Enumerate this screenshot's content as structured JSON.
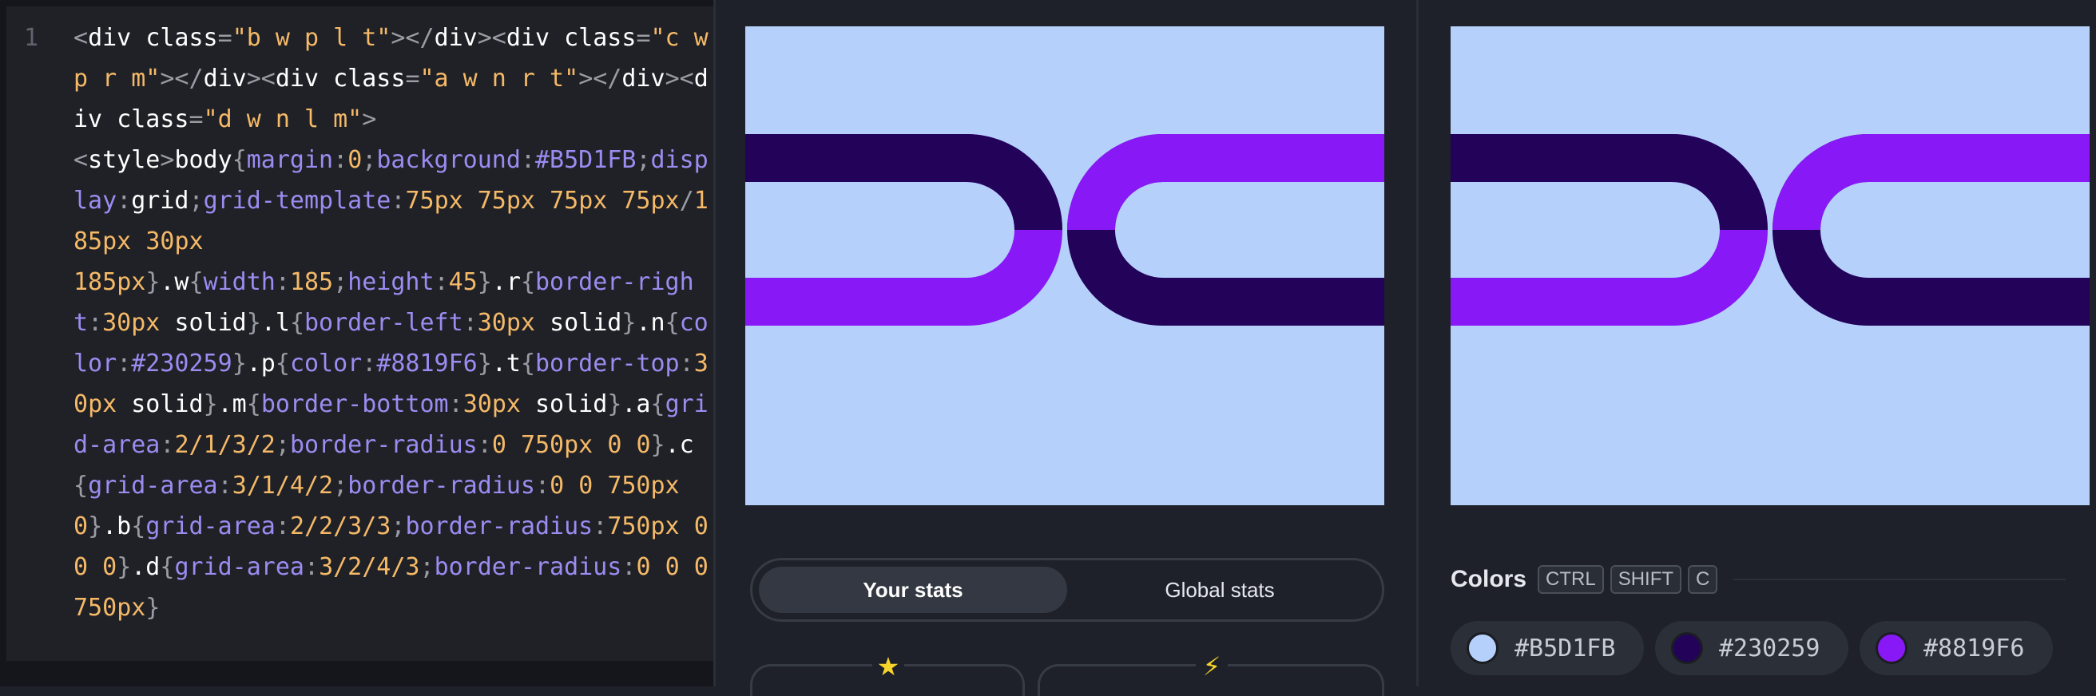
{
  "editor": {
    "line_number": "1",
    "code_tokens": [
      {
        "t": "<",
        "c": "pu"
      },
      {
        "t": "div ",
        "c": "tg"
      },
      {
        "t": "class",
        "c": "at"
      },
      {
        "t": "=",
        "c": "pu"
      },
      {
        "t": "\"b w p l t\"",
        "c": "st"
      },
      {
        "t": "></",
        "c": "pu"
      },
      {
        "t": "div",
        "c": "tg"
      },
      {
        "t": "><",
        "c": "pu"
      },
      {
        "t": "div ",
        "c": "tg"
      },
      {
        "t": "class",
        "c": "at"
      },
      {
        "t": "=",
        "c": "pu"
      },
      {
        "t": "\"c w p r m\"",
        "c": "st"
      },
      {
        "t": "></",
        "c": "pu"
      },
      {
        "t": "div",
        "c": "tg"
      },
      {
        "t": "><",
        "c": "pu"
      },
      {
        "t": "div ",
        "c": "tg"
      },
      {
        "t": "class",
        "c": "at"
      },
      {
        "t": "=",
        "c": "pu"
      },
      {
        "t": "\"a w n r t\"",
        "c": "st"
      },
      {
        "t": "></",
        "c": "pu"
      },
      {
        "t": "div",
        "c": "tg"
      },
      {
        "t": "><",
        "c": "pu"
      },
      {
        "t": "div ",
        "c": "tg"
      },
      {
        "t": "class",
        "c": "at"
      },
      {
        "t": "=",
        "c": "pu"
      },
      {
        "t": "\"d w n l m\"",
        "c": "st"
      },
      {
        "t": ">",
        "c": "pu"
      },
      {
        "t": "\n",
        "c": "pu"
      },
      {
        "t": "<",
        "c": "pu"
      },
      {
        "t": "style",
        "c": "tg"
      },
      {
        "t": ">",
        "c": "pu"
      },
      {
        "t": "body",
        "c": "sel"
      },
      {
        "t": "{",
        "c": "pu"
      },
      {
        "t": "margin",
        "c": "pr"
      },
      {
        "t": ":",
        "c": "pu"
      },
      {
        "t": "0",
        "c": "nm"
      },
      {
        "t": ";",
        "c": "pu"
      },
      {
        "t": "background",
        "c": "pr"
      },
      {
        "t": ":",
        "c": "pu"
      },
      {
        "t": "#B5D1FB",
        "c": "pr"
      },
      {
        "t": ";",
        "c": "pu"
      },
      {
        "t": "display",
        "c": "pr"
      },
      {
        "t": ":",
        "c": "pu"
      },
      {
        "t": "grid",
        "c": "sel"
      },
      {
        "t": ";",
        "c": "pu"
      },
      {
        "t": "grid-template",
        "c": "pr"
      },
      {
        "t": ":",
        "c": "pu"
      },
      {
        "t": "75",
        "c": "nm"
      },
      {
        "t": "px ",
        "c": "nm"
      },
      {
        "t": "75",
        "c": "nm"
      },
      {
        "t": "px ",
        "c": "nm"
      },
      {
        "t": "75",
        "c": "nm"
      },
      {
        "t": "px ",
        "c": "nm"
      },
      {
        "t": "75",
        "c": "nm"
      },
      {
        "t": "px",
        "c": "nm"
      },
      {
        "t": "/",
        "c": "pu"
      },
      {
        "t": "185",
        "c": "nm"
      },
      {
        "t": "px ",
        "c": "nm"
      },
      {
        "t": "30",
        "c": "nm"
      },
      {
        "t": "px",
        "c": "nm"
      },
      {
        "t": "\n",
        "c": "pu"
      },
      {
        "t": "185",
        "c": "nm"
      },
      {
        "t": "px",
        "c": "nm"
      },
      {
        "t": "}",
        "c": "pu"
      },
      {
        "t": ".w",
        "c": "sel"
      },
      {
        "t": "{",
        "c": "pu"
      },
      {
        "t": "width",
        "c": "pr"
      },
      {
        "t": ":",
        "c": "pu"
      },
      {
        "t": "185",
        "c": "nm"
      },
      {
        "t": ";",
        "c": "pu"
      },
      {
        "t": "height",
        "c": "pr"
      },
      {
        "t": ":",
        "c": "pu"
      },
      {
        "t": "45",
        "c": "nm"
      },
      {
        "t": "}",
        "c": "pu"
      },
      {
        "t": ".r",
        "c": "sel"
      },
      {
        "t": "{",
        "c": "pu"
      },
      {
        "t": "border-right",
        "c": "pr"
      },
      {
        "t": ":",
        "c": "pu"
      },
      {
        "t": "30",
        "c": "nm"
      },
      {
        "t": "px ",
        "c": "nm"
      },
      {
        "t": "solid",
        "c": "sel"
      },
      {
        "t": "}",
        "c": "pu"
      },
      {
        "t": ".l",
        "c": "sel"
      },
      {
        "t": "{",
        "c": "pu"
      },
      {
        "t": "border-left",
        "c": "pr"
      },
      {
        "t": ":",
        "c": "pu"
      },
      {
        "t": "30",
        "c": "nm"
      },
      {
        "t": "px ",
        "c": "nm"
      },
      {
        "t": "solid",
        "c": "sel"
      },
      {
        "t": "}",
        "c": "pu"
      },
      {
        "t": ".n",
        "c": "sel"
      },
      {
        "t": "{",
        "c": "pu"
      },
      {
        "t": "color",
        "c": "pr"
      },
      {
        "t": ":",
        "c": "pu"
      },
      {
        "t": "#230259",
        "c": "pr"
      },
      {
        "t": "}",
        "c": "pu"
      },
      {
        "t": ".p",
        "c": "sel"
      },
      {
        "t": "{",
        "c": "pu"
      },
      {
        "t": "color",
        "c": "pr"
      },
      {
        "t": ":",
        "c": "pu"
      },
      {
        "t": "#8819F6",
        "c": "pr"
      },
      {
        "t": "}",
        "c": "pu"
      },
      {
        "t": ".t",
        "c": "sel"
      },
      {
        "t": "{",
        "c": "pu"
      },
      {
        "t": "border-top",
        "c": "pr"
      },
      {
        "t": ":",
        "c": "pu"
      },
      {
        "t": "30",
        "c": "nm"
      },
      {
        "t": "px ",
        "c": "nm"
      },
      {
        "t": "solid",
        "c": "sel"
      },
      {
        "t": "}",
        "c": "pu"
      },
      {
        "t": ".m",
        "c": "sel"
      },
      {
        "t": "{",
        "c": "pu"
      },
      {
        "t": "border-bottom",
        "c": "pr"
      },
      {
        "t": ":",
        "c": "pu"
      },
      {
        "t": "30",
        "c": "nm"
      },
      {
        "t": "px ",
        "c": "nm"
      },
      {
        "t": "solid",
        "c": "sel"
      },
      {
        "t": "}",
        "c": "pu"
      },
      {
        "t": ".a",
        "c": "sel"
      },
      {
        "t": "{",
        "c": "pu"
      },
      {
        "t": "grid-area",
        "c": "pr"
      },
      {
        "t": ":",
        "c": "pu"
      },
      {
        "t": "2/1/3/2",
        "c": "nm"
      },
      {
        "t": ";",
        "c": "pu"
      },
      {
        "t": "border-radius",
        "c": "pr"
      },
      {
        "t": ":",
        "c": "pu"
      },
      {
        "t": "0 ",
        "c": "nm"
      },
      {
        "t": "750",
        "c": "nm"
      },
      {
        "t": "px ",
        "c": "nm"
      },
      {
        "t": "0 ",
        "c": "nm"
      },
      {
        "t": "0",
        "c": "nm"
      },
      {
        "t": "}",
        "c": "pu"
      },
      {
        "t": ".c",
        "c": "sel"
      },
      {
        "t": "{",
        "c": "pu"
      },
      {
        "t": "grid-area",
        "c": "pr"
      },
      {
        "t": ":",
        "c": "pu"
      },
      {
        "t": "3/1/4/2",
        "c": "nm"
      },
      {
        "t": ";",
        "c": "pu"
      },
      {
        "t": "border-radius",
        "c": "pr"
      },
      {
        "t": ":",
        "c": "pu"
      },
      {
        "t": "0 ",
        "c": "nm"
      },
      {
        "t": "0 ",
        "c": "nm"
      },
      {
        "t": "750",
        "c": "nm"
      },
      {
        "t": "px ",
        "c": "nm"
      },
      {
        "t": "0",
        "c": "nm"
      },
      {
        "t": "}",
        "c": "pu"
      },
      {
        "t": ".b",
        "c": "sel"
      },
      {
        "t": "{",
        "c": "pu"
      },
      {
        "t": "grid-area",
        "c": "pr"
      },
      {
        "t": ":",
        "c": "pu"
      },
      {
        "t": "2/2/3/3",
        "c": "nm"
      },
      {
        "t": ";",
        "c": "pu"
      },
      {
        "t": "border-radius",
        "c": "pr"
      },
      {
        "t": ":",
        "c": "pu"
      },
      {
        "t": "750",
        "c": "nm"
      },
      {
        "t": "px ",
        "c": "nm"
      },
      {
        "t": "0 ",
        "c": "nm"
      },
      {
        "t": "0 ",
        "c": "nm"
      },
      {
        "t": "0",
        "c": "nm"
      },
      {
        "t": "}",
        "c": "pu"
      },
      {
        "t": ".d",
        "c": "sel"
      },
      {
        "t": "{",
        "c": "pu"
      },
      {
        "t": "grid-area",
        "c": "pr"
      },
      {
        "t": ":",
        "c": "pu"
      },
      {
        "t": "3/2/4/3",
        "c": "nm"
      },
      {
        "t": ";",
        "c": "pu"
      },
      {
        "t": "border-radius",
        "c": "pr"
      },
      {
        "t": ":",
        "c": "pu"
      },
      {
        "t": "0 ",
        "c": "nm"
      },
      {
        "t": "0 ",
        "c": "nm"
      },
      {
        "t": "0 ",
        "c": "nm"
      },
      {
        "t": "750",
        "c": "nm"
      },
      {
        "t": "px",
        "c": "nm"
      },
      {
        "t": "}",
        "c": "pu"
      }
    ]
  },
  "preview": {
    "background": "#B5D1FB",
    "dark": "#230259",
    "purple": "#8819F6"
  },
  "stats": {
    "tabs": [
      {
        "label": "Your stats",
        "active": true
      },
      {
        "label": "Global stats",
        "active": false
      }
    ],
    "cards": [
      {
        "icon": "star-icon",
        "glyph": "★"
      },
      {
        "icon": "lightning-icon",
        "glyph": "⚡"
      }
    ]
  },
  "colors": {
    "title": "Colors",
    "shortcut_keys": [
      "CTRL",
      "SHIFT",
      "C"
    ],
    "swatches": [
      {
        "hex": "#B5D1FB"
      },
      {
        "hex": "#230259"
      },
      {
        "hex": "#8819F6"
      }
    ]
  }
}
